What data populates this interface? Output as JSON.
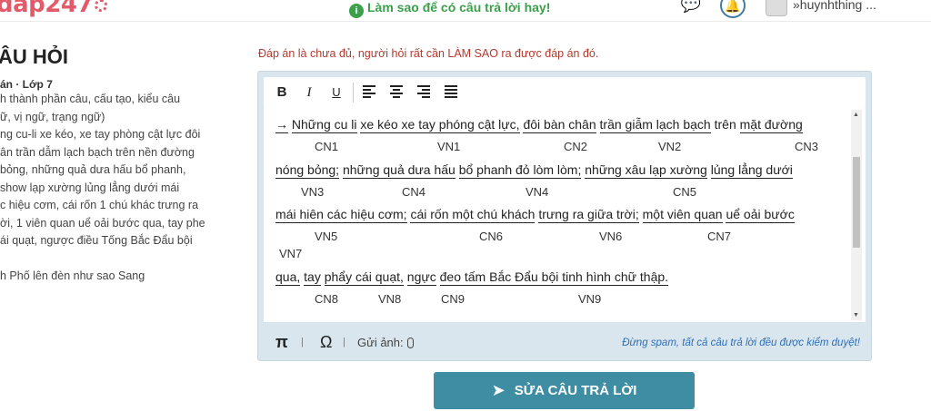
{
  "header": {
    "logo_text": "dap247",
    "hint_text": "Làm sao để có câu trả lời hay!",
    "username": "huynhthing ..."
  },
  "question": {
    "title": "ÂU HỎI",
    "meta": "án · Lớp 7",
    "lines": [
      "h thành phần câu, cấu tạo, kiểu câu",
      "ữ, vị ngữ, trạng ngữ)",
      "ng cu-li xe kéo, xe tay phòng cật lực đôi",
      "ân trần dẫm lạch bạch trên nền đường",
      "bỏng, những quả dưa hấu bổ phanh,",
      "show lạp xường lủng lẳng dưới mái",
      "c hiệu cơm, cái rốn 1 chú khác trưng ra",
      "ời, 1 viên quan uể oải bước qua, tay phe",
      "ái quạt, ngược điều Tống Bắc Đẩu bội",
      "",
      "h Phố lên đèn như sao Sang"
    ]
  },
  "editor": {
    "note": "Đáp án là chưa đủ, người hỏi rất cần LÀM SAO ra được đáp án đó.",
    "toolbar": {
      "bold": "B",
      "italic": "I",
      "underline": "U"
    },
    "content": {
      "line1": {
        "arrow": "→",
        "s1": "Những cu li",
        "s2": "xe kéo xe tay phóng cật lực,",
        "s3": "đôi bàn chân",
        "s4": "trần giẫm lạch bạch",
        "s5": "trên",
        "s6": "mặt đường"
      },
      "line1_labels": [
        "CN1",
        "VN1",
        "CN2",
        "VN2",
        "CN3"
      ],
      "line2": {
        "s1": "nóng bỏng;",
        "s2": "những quả dưa hấu",
        "s3": "bổ phanh đỏ lòm lòm;",
        "s4": "những xâu lạp xường",
        "s5": "lủng lẳng dưới"
      },
      "line2_labels": [
        "VN3",
        "CN4",
        "VN4",
        "CN5"
      ],
      "line3": {
        "s1": "mái hiên các hiệu cơm;",
        "s2": "cái rốn một chú khách",
        "s3": "trưng ra giữa trời;",
        "s4": "một viên quan",
        "s5": "uể oải bước"
      },
      "line3_labels": [
        "VN5",
        "CN6",
        "VN6",
        "CN7",
        "VN7"
      ],
      "line4": {
        "s1": "qua,",
        "s2": "tay",
        "s3": "phẩy cái quạt,",
        "s4": "ngực",
        "s5": "đeo tấm Bắc Đẩu bội tinh hình chữ thập."
      },
      "line4_labels": [
        "CN8",
        "VN8",
        "CN9",
        "VN9"
      ]
    },
    "footer": {
      "pi": "π",
      "omega": "Ω",
      "sep": "|",
      "upload_label": "Gửi ảnh:",
      "spam_note": "Đừng spam, tất cả câu trả lời đều được kiểm duyệt!"
    }
  },
  "submit": {
    "label": "SỬA CÂU TRẢ LỜI"
  },
  "colors": {
    "accent": "#3f8da3",
    "warning": "#b23a2e",
    "hint": "#3aa04a",
    "link": "#2f6fb7"
  }
}
